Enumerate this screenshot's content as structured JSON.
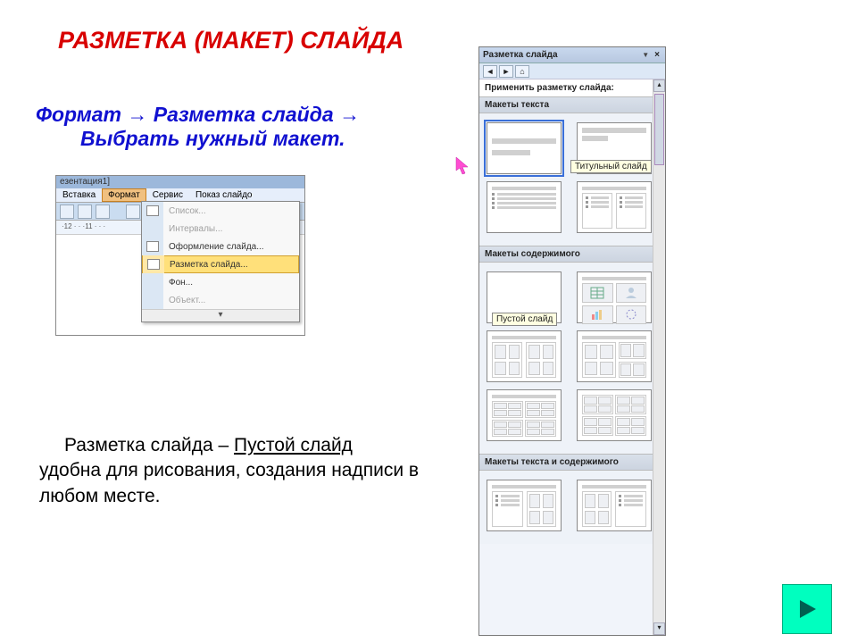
{
  "title": "РАЗМЕТКА (МАКЕТ) СЛАЙДА",
  "instruction": {
    "p1": "Формат",
    "arrow1": "→",
    "p2": "Разметка слайда",
    "arrow2": "→",
    "p3": "Выбрать нужный макет."
  },
  "menu_shot": {
    "window_title": "езентация1]",
    "menubar": [
      "Вставка",
      "Формат",
      "Сервис",
      "Показ слайдо"
    ],
    "highlighted_menu": "Формат",
    "ruler_text": "·12 · · ·11 · · ·",
    "items": [
      {
        "label": "Список...",
        "disabled": true
      },
      {
        "label": "Интервалы...",
        "disabled": true
      },
      {
        "label": "Оформление слайда...",
        "disabled": false
      },
      {
        "label": "Разметка слайда...",
        "disabled": false,
        "highlight": true
      },
      {
        "label": "Фон...",
        "disabled": false
      },
      {
        "label": "Объект...",
        "disabled": true
      }
    ],
    "expand": "▾"
  },
  "body_text": {
    "line1a": "Разметка слайда – ",
    "line1b": "Пустой слайд",
    "line2": "удобна для рисования, создания надписи в любом месте."
  },
  "pane": {
    "title": "Разметка слайда",
    "sub": "Применить разметку слайда:",
    "group1": "Макеты текста",
    "tooltip1": "Титульный слайд",
    "group2": "Макеты содержимого",
    "tooltip2": "Пустой слайд",
    "group3": "Макеты текста и содержимого"
  },
  "nav": {
    "next": "▶"
  }
}
